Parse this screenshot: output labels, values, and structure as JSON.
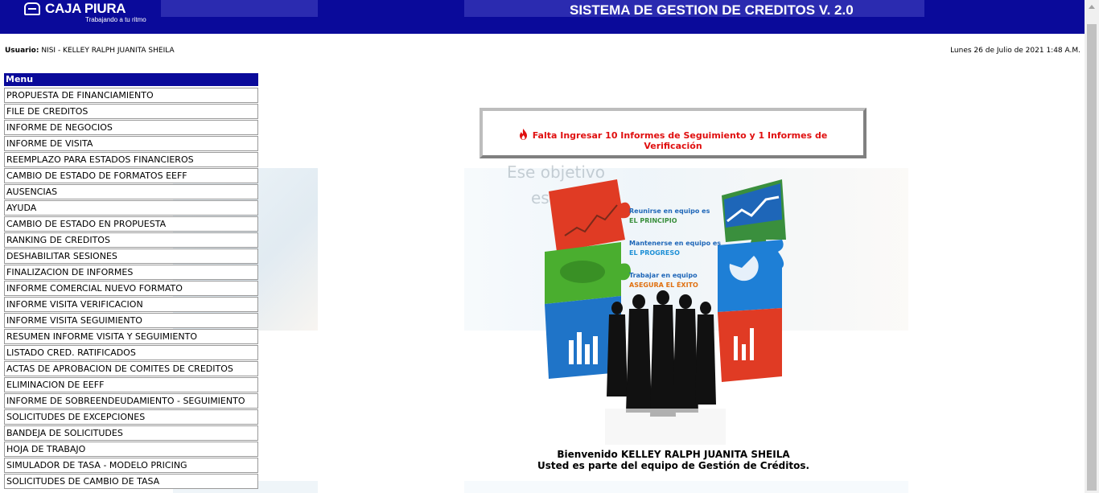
{
  "header": {
    "brand_name": "CAJA PIURA",
    "tagline": "Trabajando a tu ritmo",
    "app_title": "SISTEMA DE GESTION DE CREDITOS V. 2.0",
    "color": "#0a0a9a"
  },
  "user_bar": {
    "user_label": "Usuario:",
    "user_value": "NISI - KELLEY RALPH JUANITA SHEILA",
    "date": "Lunes 26 de Julio de 2021 1:48 A.M."
  },
  "menu": {
    "title": "Menu",
    "items": [
      "PROPUESTA DE FINANCIAMIENTO",
      "FILE DE CREDITOS",
      "INFORME DE NEGOCIOS",
      "INFORME DE VISITA",
      "REEMPLAZO PARA ESTADOS FINANCIEROS",
      "CAMBIO DE ESTADO DE FORMATOS EEFF",
      "AUSENCIAS",
      "AYUDA",
      "CAMBIO DE ESTADO EN PROPUESTA",
      "RANKING DE CREDITOS",
      "DESHABILITAR SESIONES",
      "FINALIZACION DE INFORMES",
      "INFORME COMERCIAL NUEVO FORMATO",
      "INFORME VISITA VERIFICACION",
      "INFORME VISITA SEGUIMIENTO",
      "RESUMEN INFORME VISITA Y SEGUIMIENTO",
      "LISTADO CRED. RATIFICADOS",
      "ACTAS DE APROBACION DE COMITES DE CREDITOS",
      "ELIMINACION DE EEFF",
      "INFORME DE SOBREENDEUDAMIENTO - SEGUIMIENTO",
      "SOLICITUDES DE EXCEPCIONES",
      "BANDEJA DE SOLICITUDES",
      "HOJA DE TRABAJO",
      "SIMULADOR DE TASA - MODELO PRICING",
      "SOLICITUDES DE CAMBIO DE TASA"
    ]
  },
  "background_text": {
    "line1": "Ese objetivo",
    "line2": "es mío"
  },
  "alert": {
    "icon": "fire-icon",
    "message": "Falta Ingresar 10 Informes de Seguimiento y 1 Informes de Verificación",
    "color": "#e01010"
  },
  "illustration": {
    "line1": "Reunirse en equipo es",
    "line1b": "EL PRINCIPIO",
    "line2": "Mantenerse en equipo es",
    "line2b": "EL PROGRESO",
    "line3": "Trabajar en equipo",
    "line3b": "ASEGURA EL ÉXITO"
  },
  "welcome": {
    "line1": "Bienvenido KELLEY RALPH JUANITA SHEILA",
    "line2": "Usted es parte del equipo de Gestión de Créditos."
  }
}
